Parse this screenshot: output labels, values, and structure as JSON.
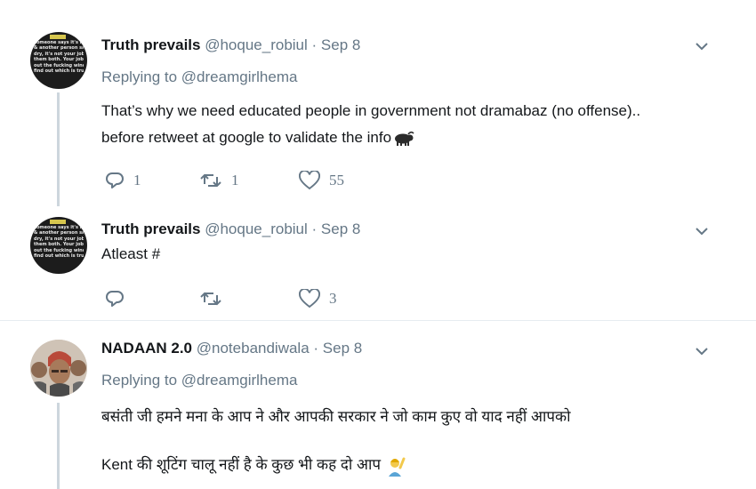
{
  "tweets": [
    {
      "author_name": "Truth prevails",
      "author_handle": "@hoque_robiul",
      "date": "Sep 8",
      "replying_label": "Replying to",
      "replying_to": "@dreamgirlhema",
      "lines": [
        "That’s why we need educated people in government not dramabaz (no offense)..",
        "before retweet at google to validate the info"
      ],
      "reply_count": "1",
      "retweet_count": "1",
      "like_count": "55",
      "avatar_text": [
        "someone says it's rain",
        "& another person says it's",
        "dry, it's not your job to quote",
        "them both. Your job is to look",
        "out the fucking window and",
        "find out which is true."
      ]
    },
    {
      "author_name": "Truth prevails",
      "author_handle": "@hoque_robiul",
      "date": "Sep 8",
      "lines": [
        "Atleast #"
      ],
      "reply_count": "",
      "retweet_count": "",
      "like_count": "3"
    },
    {
      "author_name": "NADAAN 2.0",
      "author_handle": "@notebandiwala",
      "date": "Sep 8",
      "replying_label": "Replying to",
      "replying_to": "@dreamgirlhema",
      "lines": [
        "बसंती जी हमने मना के आप ने और आपकी सरकार ने जो काम कुए वो याद नहीं आपको",
        "Kent  की शूटिंग चालू नहीं है के कुछ भी कह दो आप"
      ]
    }
  ],
  "separator": " · ",
  "icons": {
    "reply": "reply-icon",
    "retweet": "retweet-icon",
    "like": "heart-icon",
    "menu": "chevron-down-icon",
    "emoji_1": "water-buffalo-emoji",
    "emoji_2": "person-raising-hand-emoji"
  },
  "colors": {
    "text": "#14171a",
    "muted": "#657786",
    "divider": "#e6ecf0",
    "thread": "#cdd6dd"
  }
}
